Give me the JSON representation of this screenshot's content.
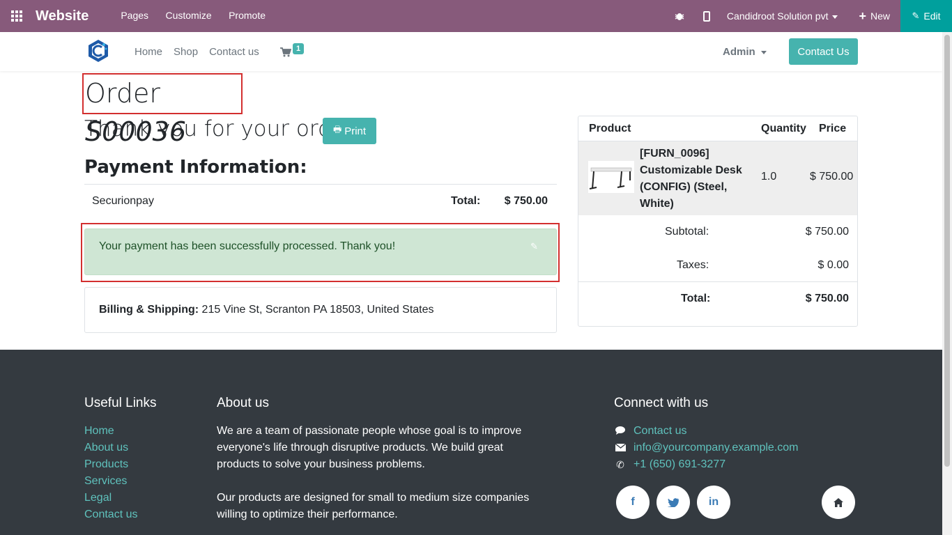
{
  "admin_bar": {
    "brand": "Website",
    "menu": [
      "Pages",
      "Customize",
      "Promote"
    ],
    "company": "Candidroot Solution pvt",
    "new_label": "New",
    "edit_label": "Edit"
  },
  "navbar": {
    "links": [
      "Home",
      "Shop",
      "Contact us"
    ],
    "cart_count": "1",
    "user": "Admin",
    "contact_button": "Contact Us"
  },
  "order": {
    "title_prefix": "Order",
    "number": "S00036",
    "thanks": "Thank you for your order.",
    "print_label": "Print",
    "payment_heading": "Payment Information:",
    "payment_method": "Securionpay",
    "total_label": "Total:",
    "total_value": "$ 750.00",
    "success_message": "Your payment has been successfully processed. Thank you!",
    "billing_label": "Billing & Shipping:",
    "billing_address": "215 Vine St, Scranton PA 18503, United States"
  },
  "summary": {
    "headers": {
      "product": "Product",
      "quantity": "Quantity",
      "price": "Price"
    },
    "line": {
      "name": "[FURN_0096] Customizable Desk (CONFIG) (Steel, White)",
      "quantity": "1.0",
      "price": "$ 750.00"
    },
    "subtotal_label": "Subtotal:",
    "subtotal_value": "$ 750.00",
    "taxes_label": "Taxes:",
    "taxes_value": "$ 0.00",
    "total_label": "Total:",
    "total_value": "$ 750.00"
  },
  "footer": {
    "useful_title": "Useful Links",
    "useful_links": [
      "Home",
      "About us",
      "Products",
      "Services",
      "Legal",
      "Contact us"
    ],
    "about_title": "About us",
    "about_p1": "We are a team of passionate people whose goal is to improve everyone's life through disruptive products. We build great products to solve your business problems.",
    "about_p2": "Our products are designed for small to medium size companies willing to optimize their performance.",
    "connect_title": "Connect with us",
    "contact_link": "Contact us",
    "email": "info@yourcompany.example.com",
    "phone": "+1 (650) 691-3277",
    "social": [
      "f",
      "in"
    ]
  },
  "colors": {
    "admin_bar": "#875a7b",
    "edit_button": "#00a09d",
    "accent": "#46b3ae",
    "success_bg": "#cfe6d4",
    "footer_bg": "#343a40",
    "footer_link": "#5fc2bd",
    "highlight_border": "#d32f2f"
  },
  "icons": [
    "apps-icon",
    "bug-icon",
    "mobile-icon",
    "plus-icon",
    "pencil-icon",
    "cart-icon",
    "printer-icon",
    "comment-icon",
    "envelope-icon",
    "phone-icon",
    "facebook-icon",
    "twitter-icon",
    "linkedin-icon",
    "home-icon"
  ]
}
